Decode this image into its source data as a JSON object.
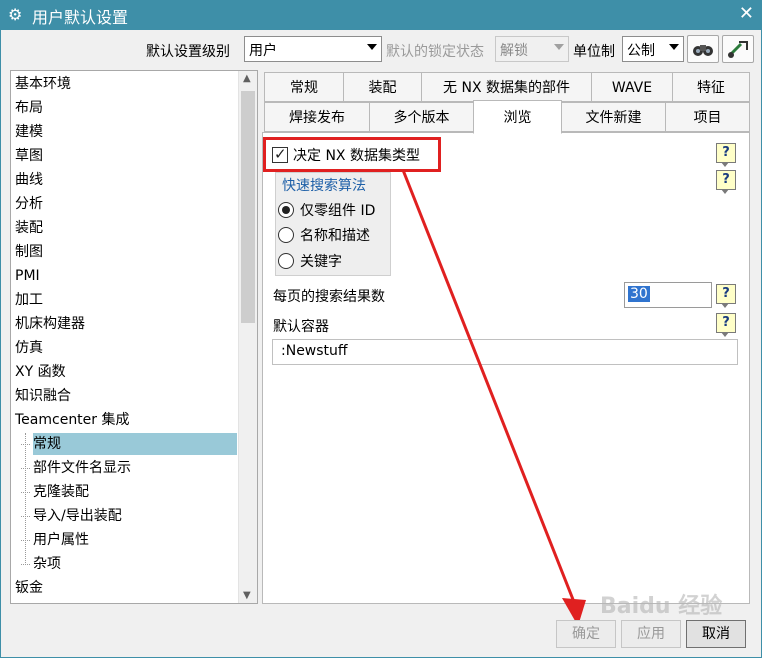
{
  "window": {
    "title": "用户默认设置",
    "close_glyph": "✕",
    "gear_glyph": "⚙"
  },
  "toolbar": {
    "level_label": "默认设置级别",
    "level_value": "用户",
    "lock_label": "默认的锁定状态",
    "lock_value": "解锁",
    "unit_label": "单位制",
    "unit_value": "公制"
  },
  "tree": {
    "items": [
      "基本环境",
      "布局",
      "建模",
      "草图",
      "曲线",
      "分析",
      "装配",
      "制图",
      "PMI",
      "加工",
      "机床构建器",
      "仿真",
      "XY 函数",
      "知识融合",
      "Teamcenter 集成"
    ],
    "children": [
      "常规",
      "部件文件名显示",
      "克隆装配",
      "导入/导出装配",
      "用户属性",
      "杂项"
    ],
    "after": [
      "钣金"
    ],
    "scroll_up": "▲",
    "scroll_down": "▼"
  },
  "tabs": {
    "row1": [
      "常规",
      "装配",
      "无 NX 数据集的部件",
      "WAVE",
      "特征"
    ],
    "row2": [
      "焊接发布",
      "多个版本",
      "浏览",
      "文件新建",
      "项目"
    ]
  },
  "panel": {
    "checkbox_label": "决定 NX 数据集类型",
    "checkbox_checked": true,
    "group_title": "快速搜索算法",
    "radios": [
      "仅零组件 ID",
      "名称和描述",
      "关键字"
    ],
    "radio_selected": 0,
    "results_label": "每页的搜索结果数",
    "results_value": "30",
    "container_label": "默认容器",
    "container_value": ":Newstuff",
    "help_glyph": "?"
  },
  "buttons": {
    "ok": "确定",
    "apply": "应用",
    "cancel": "取消"
  },
  "watermark": "Baidu 经验",
  "colors": {
    "titlebar": "#3e8fa8",
    "selected": "#99c9d8",
    "annotation_red": "#e02020"
  }
}
